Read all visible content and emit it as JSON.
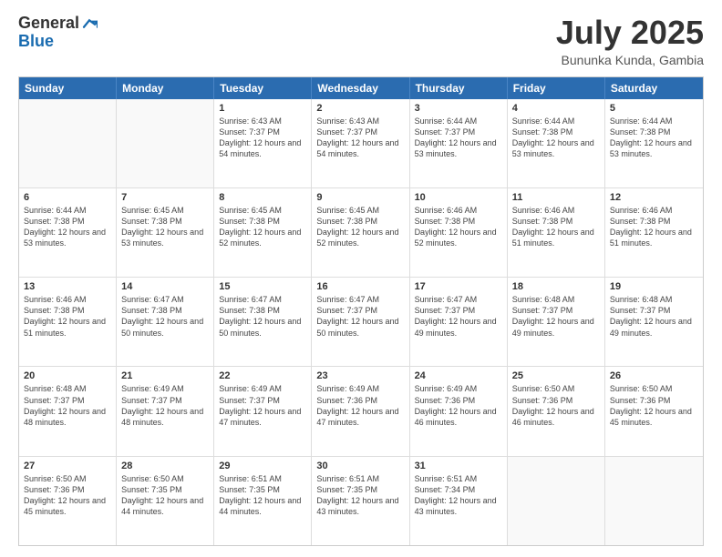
{
  "header": {
    "logo_line1": "General",
    "logo_line2": "Blue",
    "main_title": "July 2025",
    "subtitle": "Bununka Kunda, Gambia"
  },
  "calendar": {
    "days_of_week": [
      "Sunday",
      "Monday",
      "Tuesday",
      "Wednesday",
      "Thursday",
      "Friday",
      "Saturday"
    ],
    "rows": [
      [
        {
          "day": "",
          "empty": true
        },
        {
          "day": "",
          "empty": true
        },
        {
          "day": "1",
          "sunrise": "6:43 AM",
          "sunset": "7:37 PM",
          "daylight": "12 hours and 54 minutes."
        },
        {
          "day": "2",
          "sunrise": "6:43 AM",
          "sunset": "7:37 PM",
          "daylight": "12 hours and 54 minutes."
        },
        {
          "day": "3",
          "sunrise": "6:44 AM",
          "sunset": "7:37 PM",
          "daylight": "12 hours and 53 minutes."
        },
        {
          "day": "4",
          "sunrise": "6:44 AM",
          "sunset": "7:38 PM",
          "daylight": "12 hours and 53 minutes."
        },
        {
          "day": "5",
          "sunrise": "6:44 AM",
          "sunset": "7:38 PM",
          "daylight": "12 hours and 53 minutes."
        }
      ],
      [
        {
          "day": "6",
          "sunrise": "6:44 AM",
          "sunset": "7:38 PM",
          "daylight": "12 hours and 53 minutes."
        },
        {
          "day": "7",
          "sunrise": "6:45 AM",
          "sunset": "7:38 PM",
          "daylight": "12 hours and 53 minutes."
        },
        {
          "day": "8",
          "sunrise": "6:45 AM",
          "sunset": "7:38 PM",
          "daylight": "12 hours and 52 minutes."
        },
        {
          "day": "9",
          "sunrise": "6:45 AM",
          "sunset": "7:38 PM",
          "daylight": "12 hours and 52 minutes."
        },
        {
          "day": "10",
          "sunrise": "6:46 AM",
          "sunset": "7:38 PM",
          "daylight": "12 hours and 52 minutes."
        },
        {
          "day": "11",
          "sunrise": "6:46 AM",
          "sunset": "7:38 PM",
          "daylight": "12 hours and 51 minutes."
        },
        {
          "day": "12",
          "sunrise": "6:46 AM",
          "sunset": "7:38 PM",
          "daylight": "12 hours and 51 minutes."
        }
      ],
      [
        {
          "day": "13",
          "sunrise": "6:46 AM",
          "sunset": "7:38 PM",
          "daylight": "12 hours and 51 minutes."
        },
        {
          "day": "14",
          "sunrise": "6:47 AM",
          "sunset": "7:38 PM",
          "daylight": "12 hours and 50 minutes."
        },
        {
          "day": "15",
          "sunrise": "6:47 AM",
          "sunset": "7:38 PM",
          "daylight": "12 hours and 50 minutes."
        },
        {
          "day": "16",
          "sunrise": "6:47 AM",
          "sunset": "7:37 PM",
          "daylight": "12 hours and 50 minutes."
        },
        {
          "day": "17",
          "sunrise": "6:47 AM",
          "sunset": "7:37 PM",
          "daylight": "12 hours and 49 minutes."
        },
        {
          "day": "18",
          "sunrise": "6:48 AM",
          "sunset": "7:37 PM",
          "daylight": "12 hours and 49 minutes."
        },
        {
          "day": "19",
          "sunrise": "6:48 AM",
          "sunset": "7:37 PM",
          "daylight": "12 hours and 49 minutes."
        }
      ],
      [
        {
          "day": "20",
          "sunrise": "6:48 AM",
          "sunset": "7:37 PM",
          "daylight": "12 hours and 48 minutes."
        },
        {
          "day": "21",
          "sunrise": "6:49 AM",
          "sunset": "7:37 PM",
          "daylight": "12 hours and 48 minutes."
        },
        {
          "day": "22",
          "sunrise": "6:49 AM",
          "sunset": "7:37 PM",
          "daylight": "12 hours and 47 minutes."
        },
        {
          "day": "23",
          "sunrise": "6:49 AM",
          "sunset": "7:36 PM",
          "daylight": "12 hours and 47 minutes."
        },
        {
          "day": "24",
          "sunrise": "6:49 AM",
          "sunset": "7:36 PM",
          "daylight": "12 hours and 46 minutes."
        },
        {
          "day": "25",
          "sunrise": "6:50 AM",
          "sunset": "7:36 PM",
          "daylight": "12 hours and 46 minutes."
        },
        {
          "day": "26",
          "sunrise": "6:50 AM",
          "sunset": "7:36 PM",
          "daylight": "12 hours and 45 minutes."
        }
      ],
      [
        {
          "day": "27",
          "sunrise": "6:50 AM",
          "sunset": "7:36 PM",
          "daylight": "12 hours and 45 minutes."
        },
        {
          "day": "28",
          "sunrise": "6:50 AM",
          "sunset": "7:35 PM",
          "daylight": "12 hours and 44 minutes."
        },
        {
          "day": "29",
          "sunrise": "6:51 AM",
          "sunset": "7:35 PM",
          "daylight": "12 hours and 44 minutes."
        },
        {
          "day": "30",
          "sunrise": "6:51 AM",
          "sunset": "7:35 PM",
          "daylight": "12 hours and 43 minutes."
        },
        {
          "day": "31",
          "sunrise": "6:51 AM",
          "sunset": "7:34 PM",
          "daylight": "12 hours and 43 minutes."
        },
        {
          "day": "",
          "empty": true
        },
        {
          "day": "",
          "empty": true
        }
      ]
    ]
  }
}
